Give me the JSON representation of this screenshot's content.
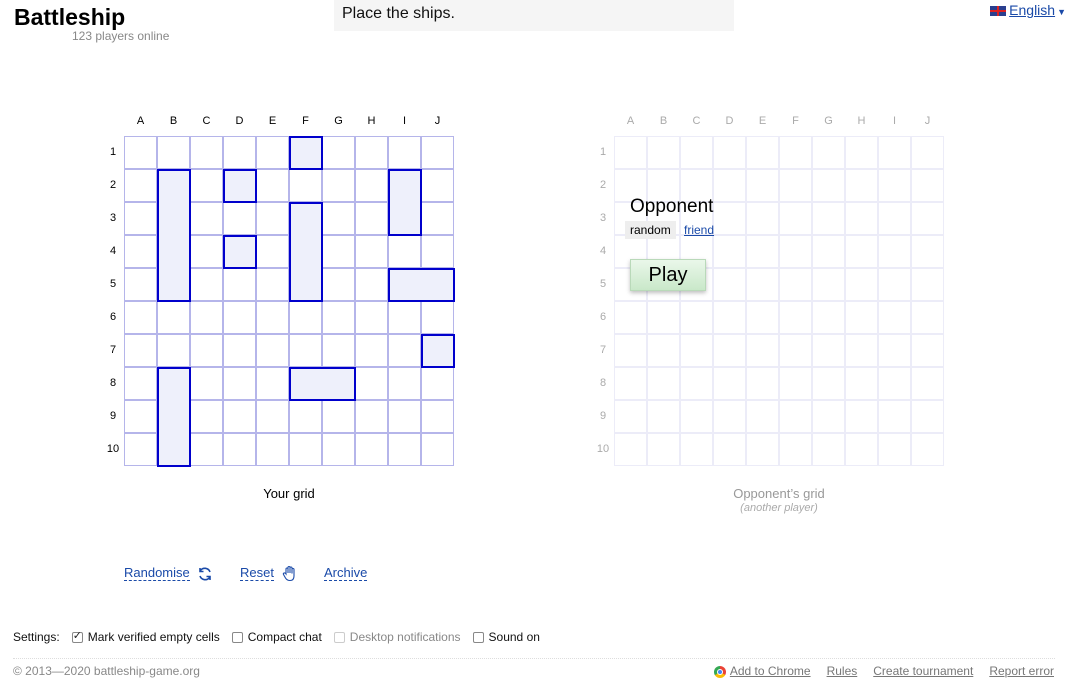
{
  "header": {
    "logo": "Battleship",
    "players_online": "123 players online",
    "status": "Place the ships.",
    "language": "English"
  },
  "board": {
    "columns": [
      "A",
      "B",
      "C",
      "D",
      "E",
      "F",
      "G",
      "H",
      "I",
      "J"
    ],
    "rows": [
      "1",
      "2",
      "3",
      "4",
      "5",
      "6",
      "7",
      "8",
      "9",
      "10"
    ],
    "ships": [
      {
        "col": 1,
        "row": 1,
        "length": 4,
        "orientation": "vertical"
      },
      {
        "col": 3,
        "row": 1,
        "length": 1,
        "orientation": "vertical"
      },
      {
        "col": 3,
        "row": 3,
        "length": 1,
        "orientation": "vertical"
      },
      {
        "col": 5,
        "row": 0,
        "length": 1,
        "orientation": "vertical"
      },
      {
        "col": 5,
        "row": 2,
        "length": 3,
        "orientation": "vertical"
      },
      {
        "col": 8,
        "row": 1,
        "length": 2,
        "orientation": "vertical"
      },
      {
        "col": 8,
        "row": 4,
        "length": 2,
        "orientation": "horizontal"
      },
      {
        "col": 9,
        "row": 6,
        "length": 1,
        "orientation": "vertical"
      },
      {
        "col": 5,
        "row": 7,
        "length": 2,
        "orientation": "horizontal"
      },
      {
        "col": 1,
        "row": 7,
        "length": 3,
        "orientation": "vertical"
      }
    ],
    "my_caption": "Your grid",
    "opponent_caption": "Opponent’s grid",
    "opponent_subcaption": "(another player)"
  },
  "opponent": {
    "title": "Opponent",
    "random_label": "random",
    "friend_label": "friend",
    "play_label": "Play"
  },
  "actions": {
    "randomise": "Randomise",
    "reset": "Reset",
    "archive": "Archive"
  },
  "settings": {
    "label": "Settings:",
    "options": [
      {
        "label": "Mark verified empty cells",
        "checked": true,
        "disabled": false
      },
      {
        "label": "Compact chat",
        "checked": false,
        "disabled": false
      },
      {
        "label": "Desktop notifications",
        "checked": false,
        "disabled": true
      },
      {
        "label": "Sound on",
        "checked": false,
        "disabled": false
      }
    ]
  },
  "footer": {
    "copyright": "© 2013—2020 battleship-game.org",
    "links": [
      "Add to Chrome",
      "Rules",
      "Create tournament",
      "Report error"
    ]
  },
  "colors": {
    "ship_border": "#0000cc",
    "ship_fill": "#eef0fb",
    "link": "#1a4aa8",
    "play_button": "#c9e8c9"
  }
}
